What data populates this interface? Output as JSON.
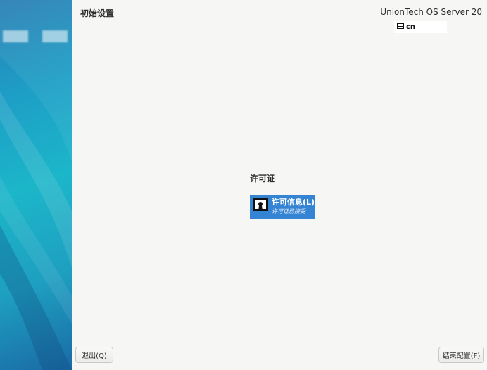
{
  "header": {
    "title": "初始设置",
    "product": "UnionTech OS Server 20",
    "keyboard_layout": "cn"
  },
  "section": {
    "title": "许可证",
    "spoke": {
      "title": "许可信息(L)",
      "status": "许可证已接受",
      "icon": "license-certificate-icon"
    }
  },
  "footer": {
    "quit_label": "退出(Q)",
    "finish_label": "结束配置(F)"
  },
  "colors": {
    "accent": "#3584d4",
    "sidebar": "#1cb6c9"
  }
}
